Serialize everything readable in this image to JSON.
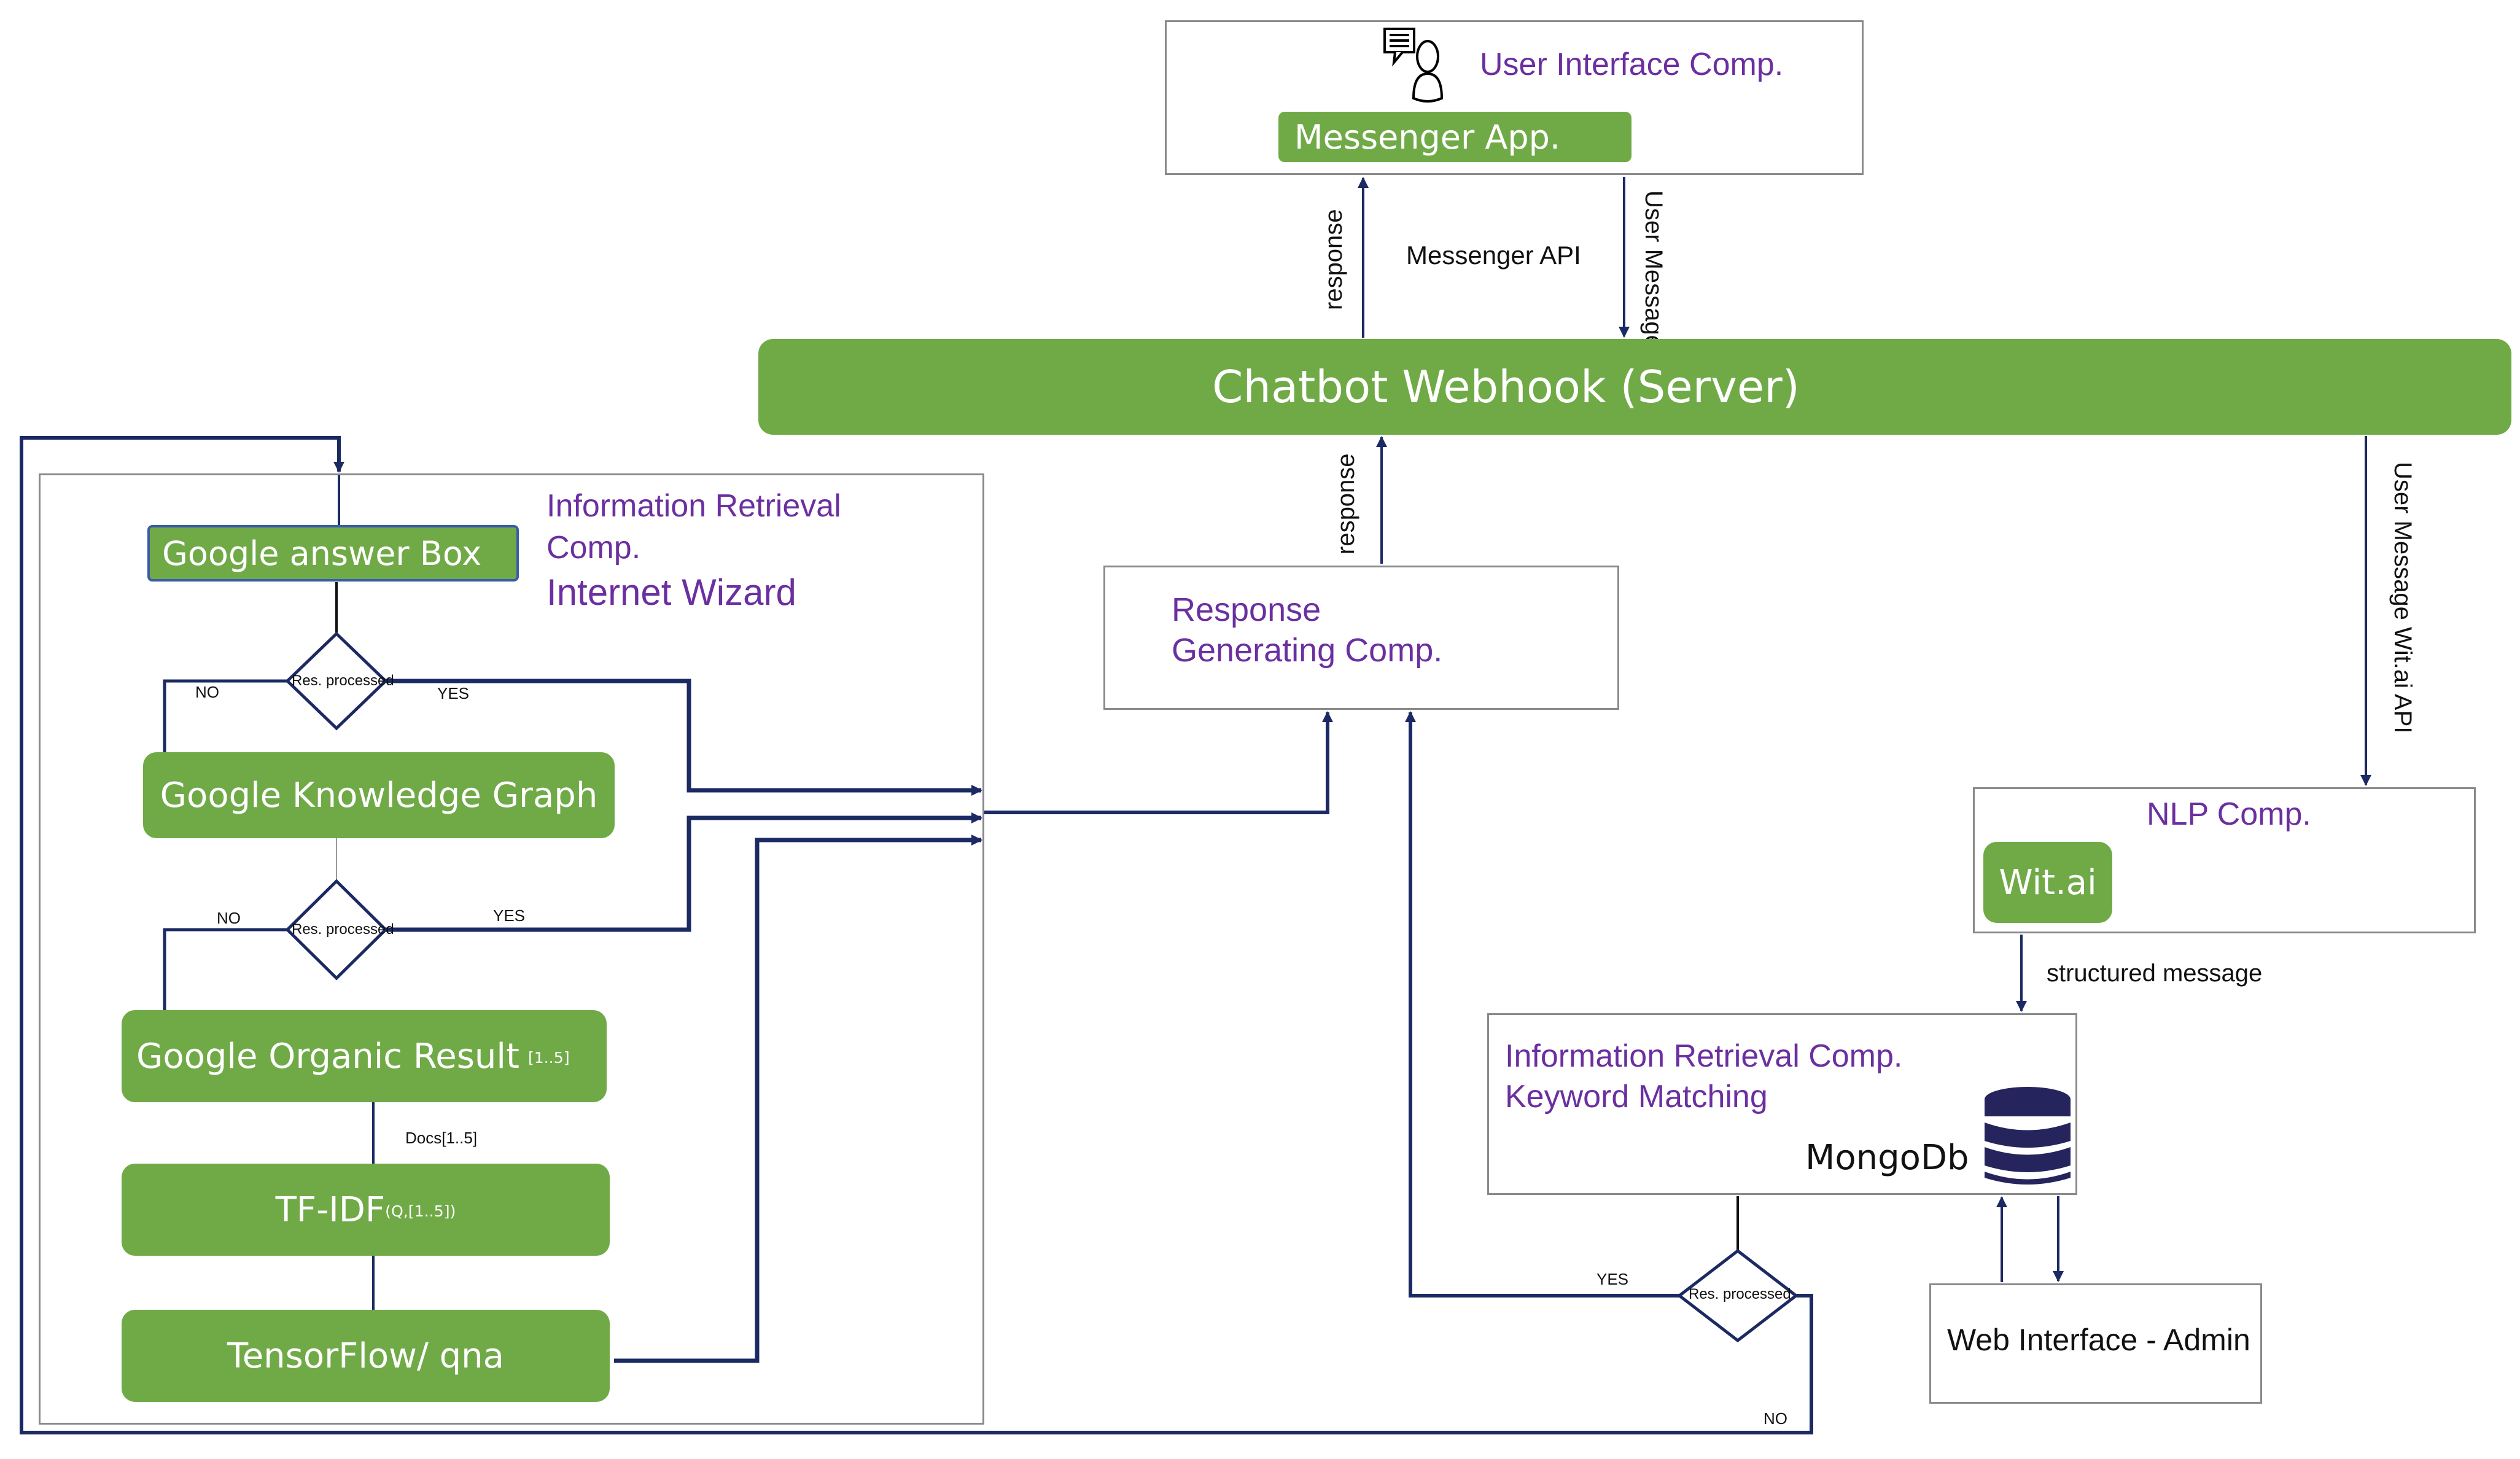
{
  "colors": {
    "component_green": "#70aa47",
    "component_title_purple": "#6b2fa0",
    "connector_navy": "#1b2a63",
    "box_border": "#8a8a8a"
  },
  "user_interface": {
    "title": "User Interface  Comp.",
    "icon": "user-chat-icon",
    "app_label": "Messenger App."
  },
  "messenger_link": {
    "response_label": "response",
    "api_label": "Messenger API",
    "user_message_label": "User Message"
  },
  "webhook": {
    "label": "Chatbot Webhook (Server)"
  },
  "response_gen": {
    "title_line1": "Response",
    "title_line2": "Generating Comp.",
    "up_label": "response"
  },
  "internet_wizard": {
    "title_line1": "Information Retrieval",
    "title_line2": "Comp.",
    "title_line3": "Internet Wizard",
    "answer_box": "Google answer Box",
    "knowledge_graph": "Google Knowledge Graph",
    "organic_result": "Google Organic Result",
    "organic_result_sub": "[1..5]",
    "docs_label": "Docs[1..5]",
    "tfidf": "TF-IDF",
    "tfidf_sub": "(Q,[1..5])",
    "tensorflow": "TensorFlow/ qna",
    "decision_1": {
      "label": "Res. processed",
      "no": "NO",
      "yes": "YES"
    },
    "decision_2": {
      "label": "Res. processed",
      "no": "NO",
      "yes": "YES"
    }
  },
  "nlp": {
    "incoming_label": "User Message Wit.ai API",
    "title": "NLP Comp.",
    "engine": "Wit.ai",
    "output_label": "structured message"
  },
  "keyword_matching": {
    "title_line1": "Information Retrieval Comp.",
    "title_line2": " Keyword Matching",
    "db_label": "MongoDb",
    "db_icon": "database-icon",
    "decision": {
      "label": "Res. processed",
      "yes": "YES",
      "no": "NO"
    }
  },
  "admin": {
    "label": "Web Interface - Admin"
  }
}
